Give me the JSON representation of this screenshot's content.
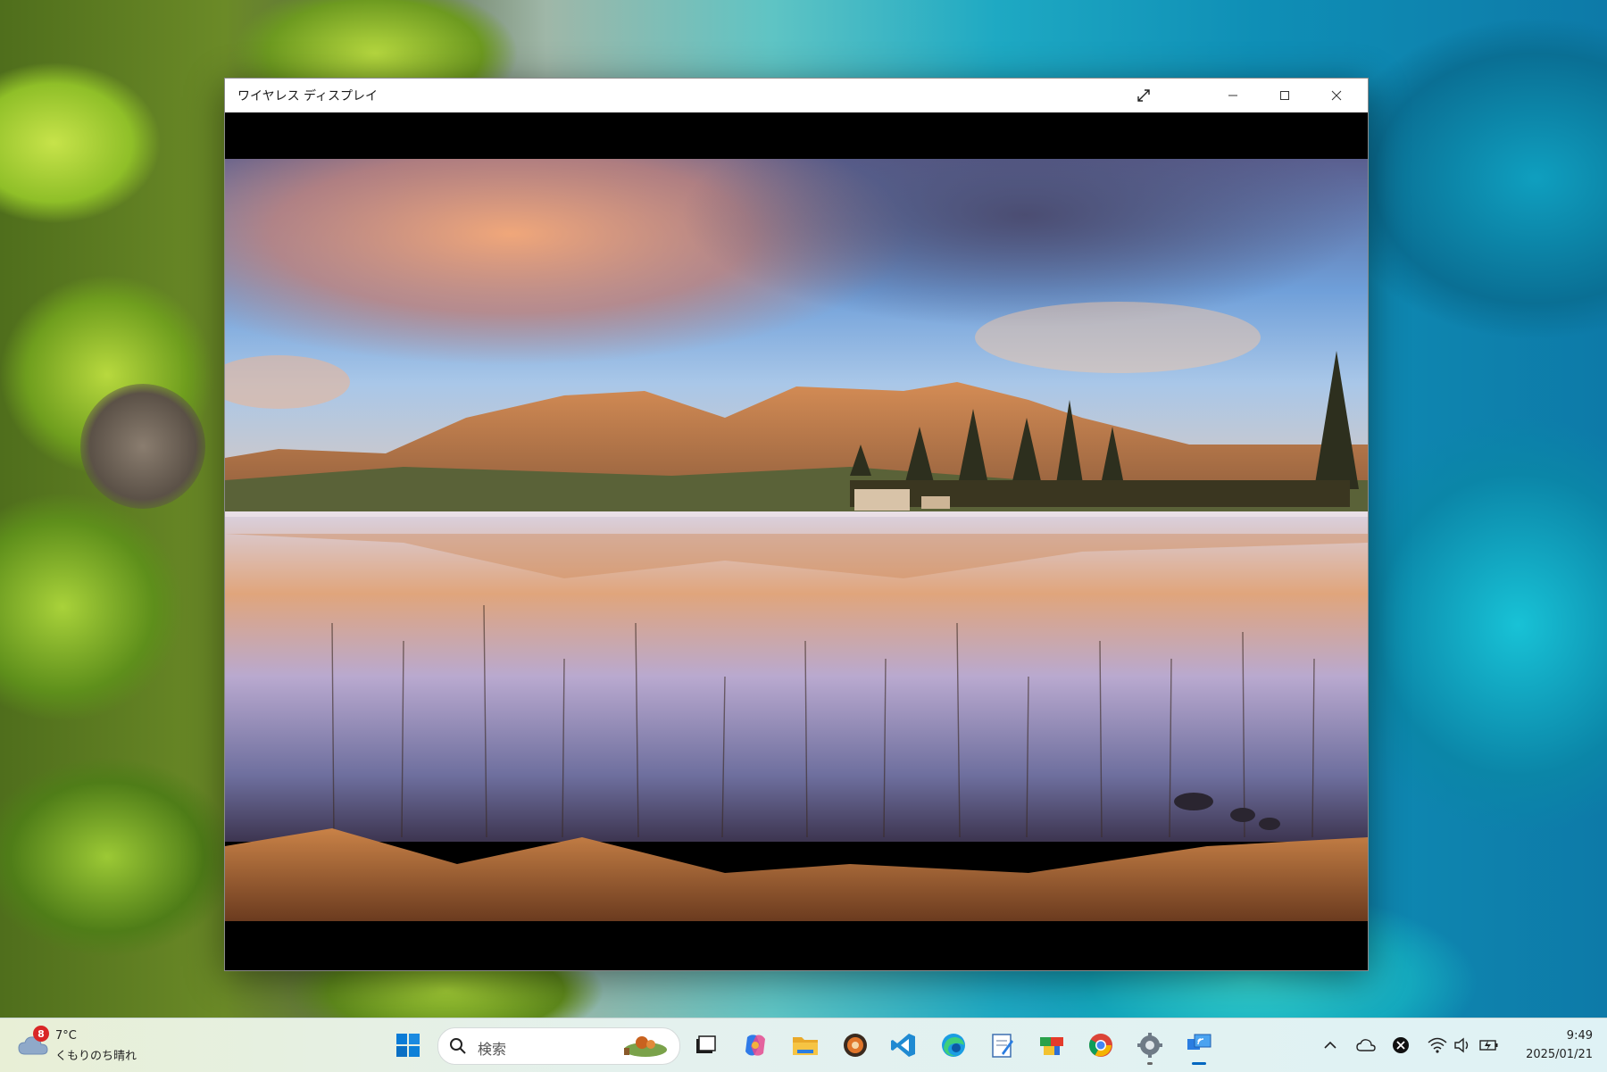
{
  "window": {
    "title": "ワイヤレス ディスプレイ"
  },
  "taskbar": {
    "weather": {
      "badge": "8",
      "temperature": "7°C",
      "condition": "くもりのち晴れ"
    },
    "search": {
      "placeholder": "検索"
    },
    "pinned_apps": [
      "start-icon",
      "task-view-icon",
      "copilot-icon",
      "file-explorer-icon",
      "app-icon",
      "vscode-icon",
      "edge-icon",
      "notepad-icon",
      "app-icon",
      "chrome-icon",
      "settings-icon",
      "wireless-display-icon"
    ],
    "clock": {
      "time": "9:49",
      "date": "2025/01/21"
    }
  },
  "colors": {
    "accent": "#0067c0"
  }
}
